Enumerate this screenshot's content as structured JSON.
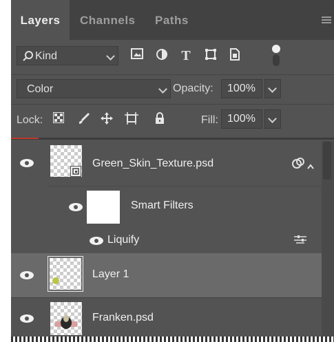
{
  "tabs": [
    "Layers",
    "Channels",
    "Paths"
  ],
  "filter": {
    "kind_label": "Kind",
    "icons": [
      "image-filter-icon",
      "adjustment-filter-icon",
      "type-filter-icon",
      "shape-filter-icon",
      "smart-object-filter-icon",
      "filter-toggle-icon"
    ],
    "type_glyph": "T"
  },
  "blend": {
    "mode": "Color",
    "opacity_label": "Opacity:",
    "opacity_value": "100%"
  },
  "lock": {
    "label": "Lock:",
    "icons": [
      "lock-transparent-pixels-icon",
      "lock-image-pixels-icon",
      "lock-position-icon",
      "lock-artboard-icon",
      "lock-all-icon"
    ],
    "fill_label": "Fill:",
    "fill_value": "100%"
  },
  "layers": [
    {
      "name": "Green_Skin_Texture.psd",
      "type": "smart-object"
    },
    {
      "name": "Smart Filters",
      "type": "smart-filters"
    },
    {
      "name": "Liquify",
      "type": "filter"
    },
    {
      "name": "Layer 1",
      "type": "pixel"
    },
    {
      "name": "Franken.psd",
      "type": "smart-object"
    }
  ],
  "colors": {
    "panel_bg": "#535353",
    "tab_bar": "#424242",
    "selected_row": "#6a6a6a",
    "red_indicator": "#c0392b"
  }
}
